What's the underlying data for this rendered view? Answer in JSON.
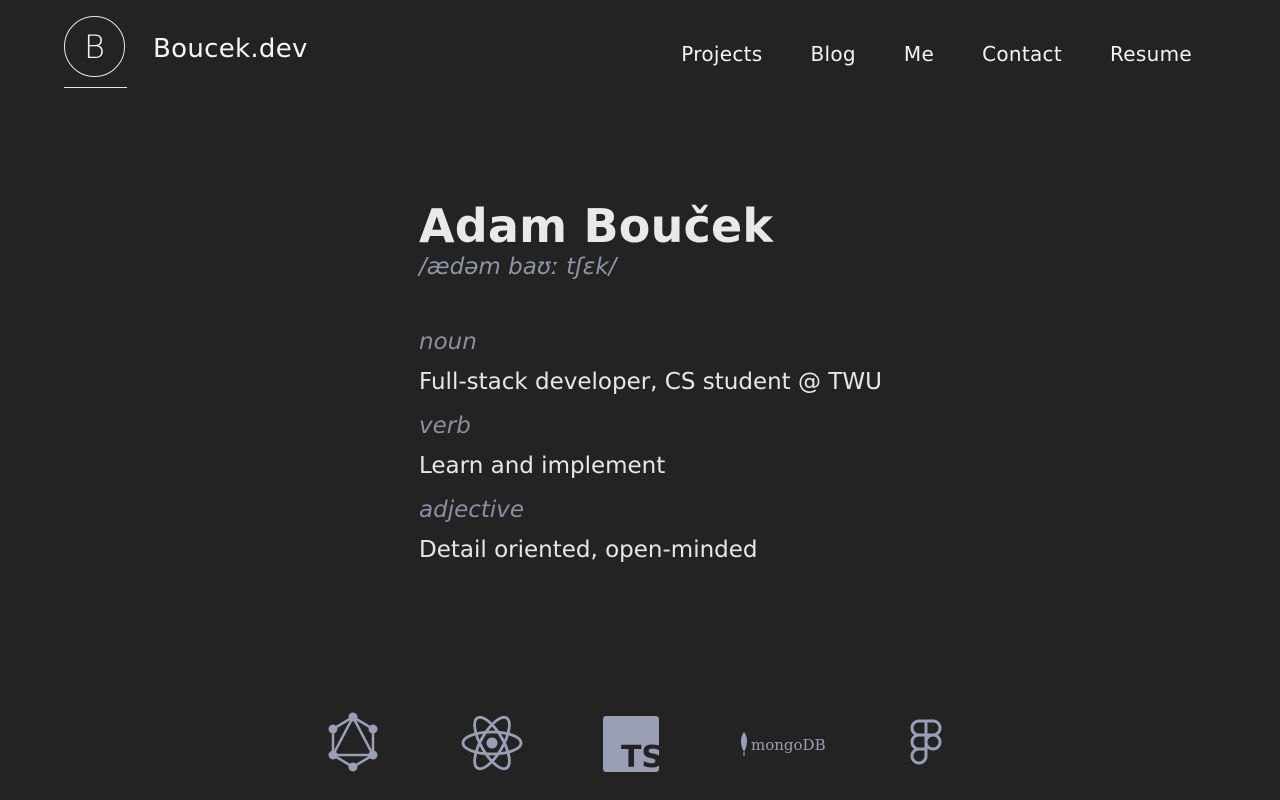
{
  "header": {
    "logo_letter": "B",
    "site_name": "Boucek.dev",
    "nav": [
      "Projects",
      "Blog",
      "Me",
      "Contact",
      "Resume"
    ]
  },
  "main": {
    "name": "Adam Bouček",
    "pronunciation": "/ædəm baʊː tʃɛk/",
    "definitions": [
      {
        "pos": "noun",
        "text": "Full-stack developer, CS student @ TWU"
      },
      {
        "pos": "verb",
        "text": "Learn and implement"
      },
      {
        "pos": "adjective",
        "text": "Detail oriented, open-minded"
      }
    ]
  },
  "tech": {
    "icons": [
      "graphql-icon",
      "react-icon",
      "typescript-icon",
      "mongodb-icon",
      "figma-icon"
    ],
    "typescript_label": "TS",
    "mongodb_label": "mongoDB",
    "icon_color": "#9a9fb6"
  },
  "colors": {
    "background": "#232323",
    "text": "#ececec",
    "muted": "#8e94a8"
  }
}
